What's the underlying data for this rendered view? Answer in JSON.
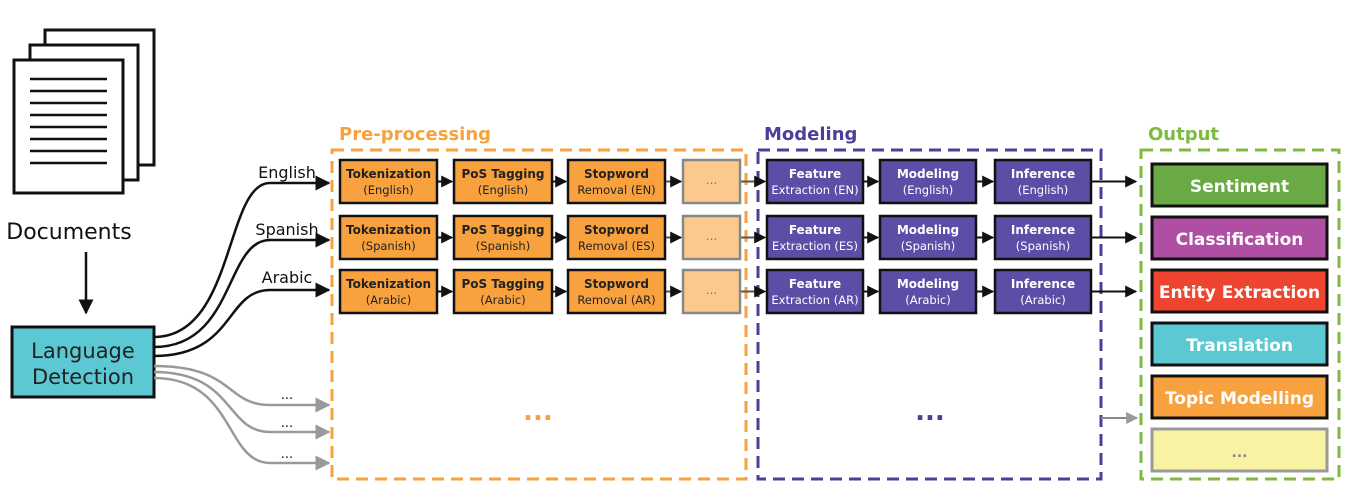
{
  "documents": {
    "label": "Documents",
    "icon": "document-stack-icon"
  },
  "language_detection": {
    "line1": "Language",
    "line2": "Detection"
  },
  "branches": [
    {
      "label": "English"
    },
    {
      "label": "Spanish"
    },
    {
      "label": "Arabic"
    },
    {
      "label": "..."
    },
    {
      "label": "..."
    },
    {
      "label": "..."
    }
  ],
  "preprocessing": {
    "title": "Pre-processing",
    "color": "#f7a23f",
    "ellipsis": "...",
    "rows": [
      [
        {
          "l1": "Tokenization",
          "l2": "(English)"
        },
        {
          "l1": "PoS Tagging",
          "l2": "(English)"
        },
        {
          "l1": "Stopword",
          "l2": "Removal (EN)"
        },
        {
          "l1": "...",
          "l2": ""
        }
      ],
      [
        {
          "l1": "Tokenization",
          "l2": "(Spanish)"
        },
        {
          "l1": "PoS Tagging",
          "l2": "(Spanish)"
        },
        {
          "l1": "Stopword",
          "l2": "Removal (ES)"
        },
        {
          "l1": "...",
          "l2": ""
        }
      ],
      [
        {
          "l1": "Tokenization",
          "l2": "(Arabic)"
        },
        {
          "l1": "PoS Tagging",
          "l2": "(Arabic)"
        },
        {
          "l1": "Stopword",
          "l2": "Removal (AR)"
        },
        {
          "l1": "...",
          "l2": ""
        }
      ]
    ]
  },
  "modeling": {
    "title": "Modeling",
    "color": "#4c3f99",
    "ellipsis": "...",
    "rows": [
      [
        {
          "l1": "Feature",
          "l2": "Extraction (EN)"
        },
        {
          "l1": "Modeling",
          "l2": "(English)"
        },
        {
          "l1": "Inference",
          "l2": "(English)"
        }
      ],
      [
        {
          "l1": "Feature",
          "l2": "Extraction (ES)"
        },
        {
          "l1": "Modeling",
          "l2": "(Spanish)"
        },
        {
          "l1": "Inference",
          "l2": "(Spanish)"
        }
      ],
      [
        {
          "l1": "Feature",
          "l2": "Extraction (AR)"
        },
        {
          "l1": "Modeling",
          "l2": "(Arabic)"
        },
        {
          "l1": "Inference",
          "l2": "(Arabic)"
        }
      ]
    ]
  },
  "output": {
    "title": "Output",
    "color": "#7dbb3f",
    "items": [
      {
        "label": "Sentiment",
        "color": "#6aaa45"
      },
      {
        "label": "Classification",
        "color": "#b04ea3"
      },
      {
        "label": "Entity Extraction",
        "color": "#ef4430"
      },
      {
        "label": "Translation",
        "color": "#5bc8d3"
      },
      {
        "label": "Topic Modelling",
        "color": "#f7a23f"
      },
      {
        "label": "...",
        "color": "#f7f3a3"
      }
    ]
  }
}
